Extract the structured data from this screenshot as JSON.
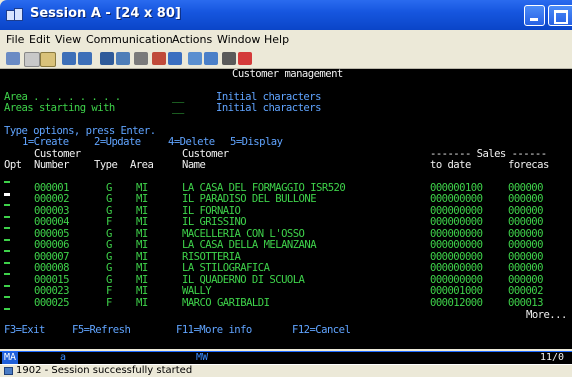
{
  "window": {
    "title": "Session A - [24 x 80]"
  },
  "menu": [
    "File",
    "Edit",
    "View",
    "Communication",
    "Actions",
    "Window",
    "Help"
  ],
  "toolbar": {
    "icons": [
      "open-icon",
      "copy-icon",
      "paste-icon",
      "send-icon",
      "receive-icon",
      "display-icon",
      "print-icon",
      "record-icon",
      "playback-icon",
      "macro-icon",
      "settings-icon",
      "color-icon",
      "help-icon"
    ]
  },
  "screen": {
    "title": "Customer management",
    "filter": {
      "area_label": "Area . . . . . . . .",
      "area_value": "__",
      "area_hint": "Initial characters",
      "areas_start_label": "Areas starting with",
      "areas_start_value": "__",
      "areas_start_hint": "Initial characters"
    },
    "instructions": "Type options, press Enter.",
    "options": [
      "1=Create",
      "2=Update",
      "4=Delete",
      "5=Display"
    ],
    "headers": {
      "row1": {
        "customer": "Customer",
        "customer_name": "Customer",
        "sales": "------- Sales ------"
      },
      "row2": {
        "opt": "Opt",
        "number": "Number",
        "type": "Type",
        "area": "Area",
        "name": "Name",
        "to_date": "to date",
        "forecast": "forecas"
      }
    },
    "rows": [
      {
        "opt": "",
        "number": "000001",
        "type": "G",
        "area": "MI",
        "name": "LA CASA DEL FORMAGGIO ISR520",
        "to_date": "000000100",
        "forecast": "000000"
      },
      {
        "opt": "",
        "number": "000002",
        "type": "G",
        "area": "MI",
        "name": "IL PARADISO DEL BULLONE",
        "to_date": "000000000",
        "forecast": "000000"
      },
      {
        "opt": "",
        "number": "000003",
        "type": "G",
        "area": "MI",
        "name": "IL FORNAIO",
        "to_date": "000000000",
        "forecast": "000000"
      },
      {
        "opt": "",
        "number": "000004",
        "type": "F",
        "area": "MI",
        "name": "IL GRISSINO",
        "to_date": "000000000",
        "forecast": "000000"
      },
      {
        "opt": "",
        "number": "000005",
        "type": "G",
        "area": "MI",
        "name": "MACELLERIA CON L'OSSO",
        "to_date": "000000000",
        "forecast": "000000"
      },
      {
        "opt": "",
        "number": "000006",
        "type": "G",
        "area": "MI",
        "name": "LA CASA DELLA MELANZANA",
        "to_date": "000000000",
        "forecast": "000000"
      },
      {
        "opt": "",
        "number": "000007",
        "type": "G",
        "area": "MI",
        "name": "RISOTTERIA",
        "to_date": "000000000",
        "forecast": "000000"
      },
      {
        "opt": "",
        "number": "000008",
        "type": "G",
        "area": "MI",
        "name": "LA STILOGRAFICA",
        "to_date": "000000000",
        "forecast": "000000"
      },
      {
        "opt": "",
        "number": "000015",
        "type": "G",
        "area": "MI",
        "name": "IL QUADERNO DI SCUOLA",
        "to_date": "000000000",
        "forecast": "000000"
      },
      {
        "opt": "",
        "number": "000023",
        "type": "F",
        "area": "MI",
        "name": "WALLY",
        "to_date": "000001000",
        "forecast": "000002"
      },
      {
        "opt": "",
        "number": "000025",
        "type": "F",
        "area": "MI",
        "name": "MARCO GARIBALDI",
        "to_date": "000012000",
        "forecast": "000013"
      }
    ],
    "more": "More...",
    "function_keys": [
      "F3=Exit",
      "F5=Refresh",
      "F11=More info",
      "F12=Cancel"
    ]
  },
  "oia": {
    "indicator": "MA",
    "mode": "a",
    "system": "MW",
    "cursor_pos": "11/0"
  },
  "statusbar": {
    "message": "1902 - Session successfully started"
  }
}
